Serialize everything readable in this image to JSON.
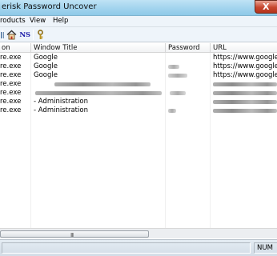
{
  "window": {
    "title": "erisk Password Uncover",
    "close_glyph": "X"
  },
  "menu": {
    "items": [
      "roducts",
      "View",
      "Help"
    ]
  },
  "toolbar": {
    "ns_label": "NS",
    "icons": [
      "toolbar-icon-partial",
      "home-icon",
      "ns-icon",
      "key-icon"
    ]
  },
  "list": {
    "columns": [
      "on",
      "Window Title",
      "Password",
      "URL"
    ],
    "rows": [
      {
        "app": "re.exe",
        "title": "Google",
        "password": "",
        "url": "https://www.google.co"
      },
      {
        "app": "re.exe",
        "title": "Google",
        "password": "[redacted]",
        "url": "https://www.google.co"
      },
      {
        "app": "re.exe",
        "title": "Google",
        "password": "[redacted]",
        "url": "https://www.google.co"
      },
      {
        "app": "re.exe",
        "title": "[redacted]",
        "password": "",
        "url": "[redacted]"
      },
      {
        "app": "re.exe",
        "title": "[redacted]",
        "password": "[redacted]",
        "url": "[redacted]"
      },
      {
        "app": "re.exe",
        "title": "- Administration",
        "password": "",
        "url": "[redacted]"
      },
      {
        "app": "re.exe",
        "title": "- Administration",
        "password": "[redacted]",
        "url": "[redacted]"
      }
    ]
  },
  "scrollbar": {
    "grip": "III"
  },
  "statusbar": {
    "main_text": "",
    "num_indicator": "NUM"
  }
}
